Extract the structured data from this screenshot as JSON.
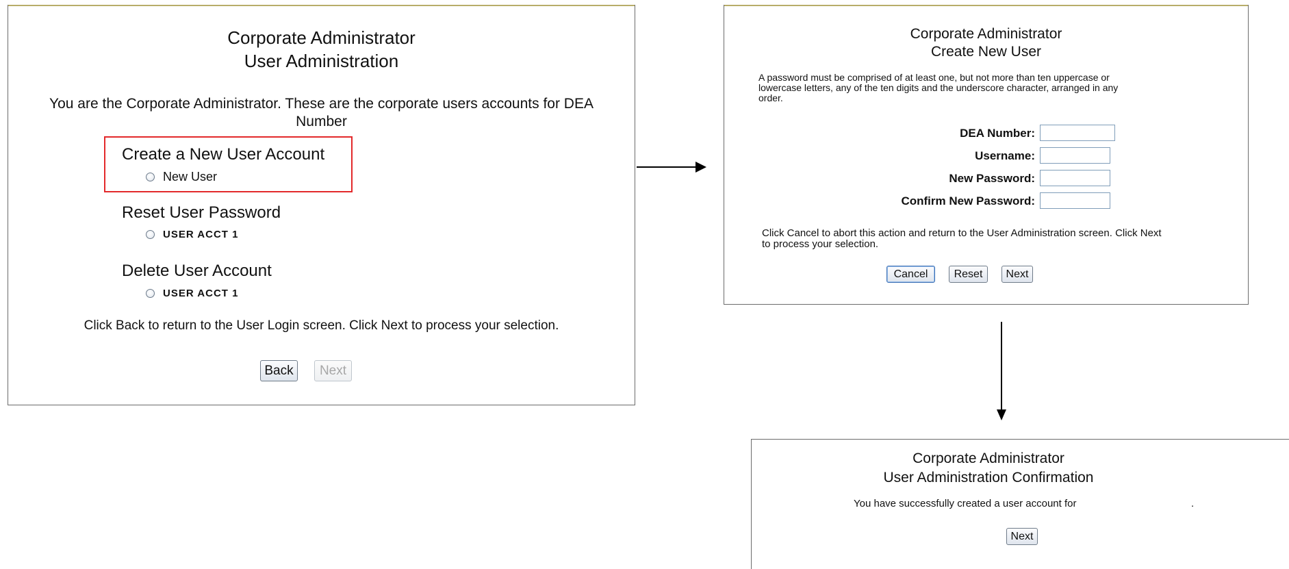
{
  "panel1": {
    "title_line1": "Corporate Administrator",
    "title_line2": "User Administration",
    "intro_line1": "You are the Corporate Administrator. These are the corporate users accounts for DEA",
    "intro_line2": "Number",
    "create_section": {
      "title": "Create a New User Account",
      "option_label": "New User"
    },
    "reset_section": {
      "title": "Reset User Password",
      "option_label": "USER ACCT 1"
    },
    "delete_section": {
      "title": "Delete User Account",
      "option_label": "USER ACCT 1"
    },
    "help_text": "Click Back to return to the User Login screen. Click Next to process your selection.",
    "back_label": "Back",
    "next_label": "Next",
    "highlight_color": "#e3282a"
  },
  "panel2": {
    "title_line1": "Corporate Administrator",
    "title_line2": "Create New User",
    "password_note_line1": "A password must be comprised of at least one, but not more than ten uppercase or",
    "password_note_line2": "lowercase letters, any of the ten digits and the underscore character, arranged in any",
    "password_note_line3": "order.",
    "fields": {
      "dea_label": "DEA Number:",
      "username_label": "Username:",
      "new_password_label": "New Password:",
      "confirm_password_label": "Confirm New Password:"
    },
    "help_line1": "Click Cancel to abort this action and return to the User Administration screen. Click Next",
    "help_line2": "to process your selection.",
    "cancel_label": "Cancel",
    "reset_label": "Reset",
    "next_label": "Next"
  },
  "panel3": {
    "title_line1": "Corporate Administrator",
    "title_line2": "User Administration Confirmation",
    "message": "You have successfully created a user account for",
    "message_end": ".",
    "next_label": "Next"
  }
}
